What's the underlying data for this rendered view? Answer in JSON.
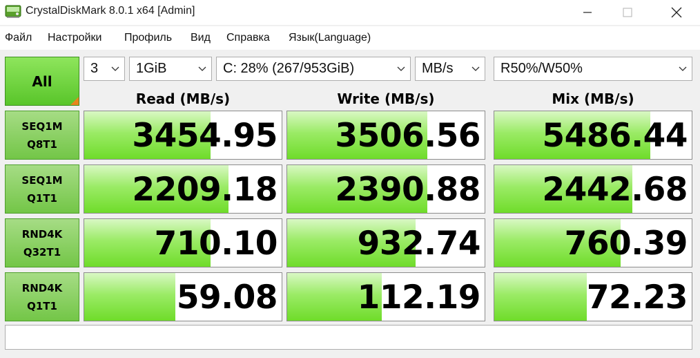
{
  "window": {
    "title": "CrystalDiskMark 8.0.1 x64 [Admin]",
    "minimize_icon": "minimize-icon",
    "maximize_icon": "maximize-icon",
    "close_icon": "close-icon"
  },
  "menu": [
    {
      "label": "Файл"
    },
    {
      "label": "Настройки"
    },
    {
      "label": "Профиль"
    },
    {
      "label": "Вид"
    },
    {
      "label": "Справка"
    },
    {
      "label": "Язык(Language)"
    }
  ],
  "controls": {
    "all_label": "All",
    "count": "3",
    "size": "1GiB",
    "drive": "C: 28% (267/953GiB)",
    "unit": "MB/s",
    "mix": "R50%/W50%"
  },
  "headers": {
    "read": "Read (MB/s)",
    "write": "Write (MB/s)",
    "mix": "Mix (MB/s)"
  },
  "rows": [
    {
      "label1": "SEQ1M",
      "label2": "Q8T1",
      "read": "3454.95",
      "read_fill": 0.64,
      "write": "3506.56",
      "write_fill": 0.71,
      "mix": "5486.44",
      "mix_fill": 0.79
    },
    {
      "label1": "SEQ1M",
      "label2": "Q1T1",
      "read": "2209.18",
      "read_fill": 0.73,
      "write": "2390.88",
      "write_fill": 0.71,
      "mix": "2442.68",
      "mix_fill": 0.7
    },
    {
      "label1": "RND4K",
      "label2": "Q32T1",
      "read": "710.10",
      "read_fill": 0.64,
      "write": "932.74",
      "write_fill": 0.65,
      "mix": "760.39",
      "mix_fill": 0.64
    },
    {
      "label1": "RND4K",
      "label2": "Q1T1",
      "read": "59.08",
      "read_fill": 0.46,
      "write": "112.19",
      "write_fill": 0.48,
      "mix": "72.23",
      "mix_fill": 0.47
    }
  ],
  "colors": {
    "accent_green": "#6fdc2a",
    "corner_orange": "#e8851c"
  },
  "status_text": ""
}
